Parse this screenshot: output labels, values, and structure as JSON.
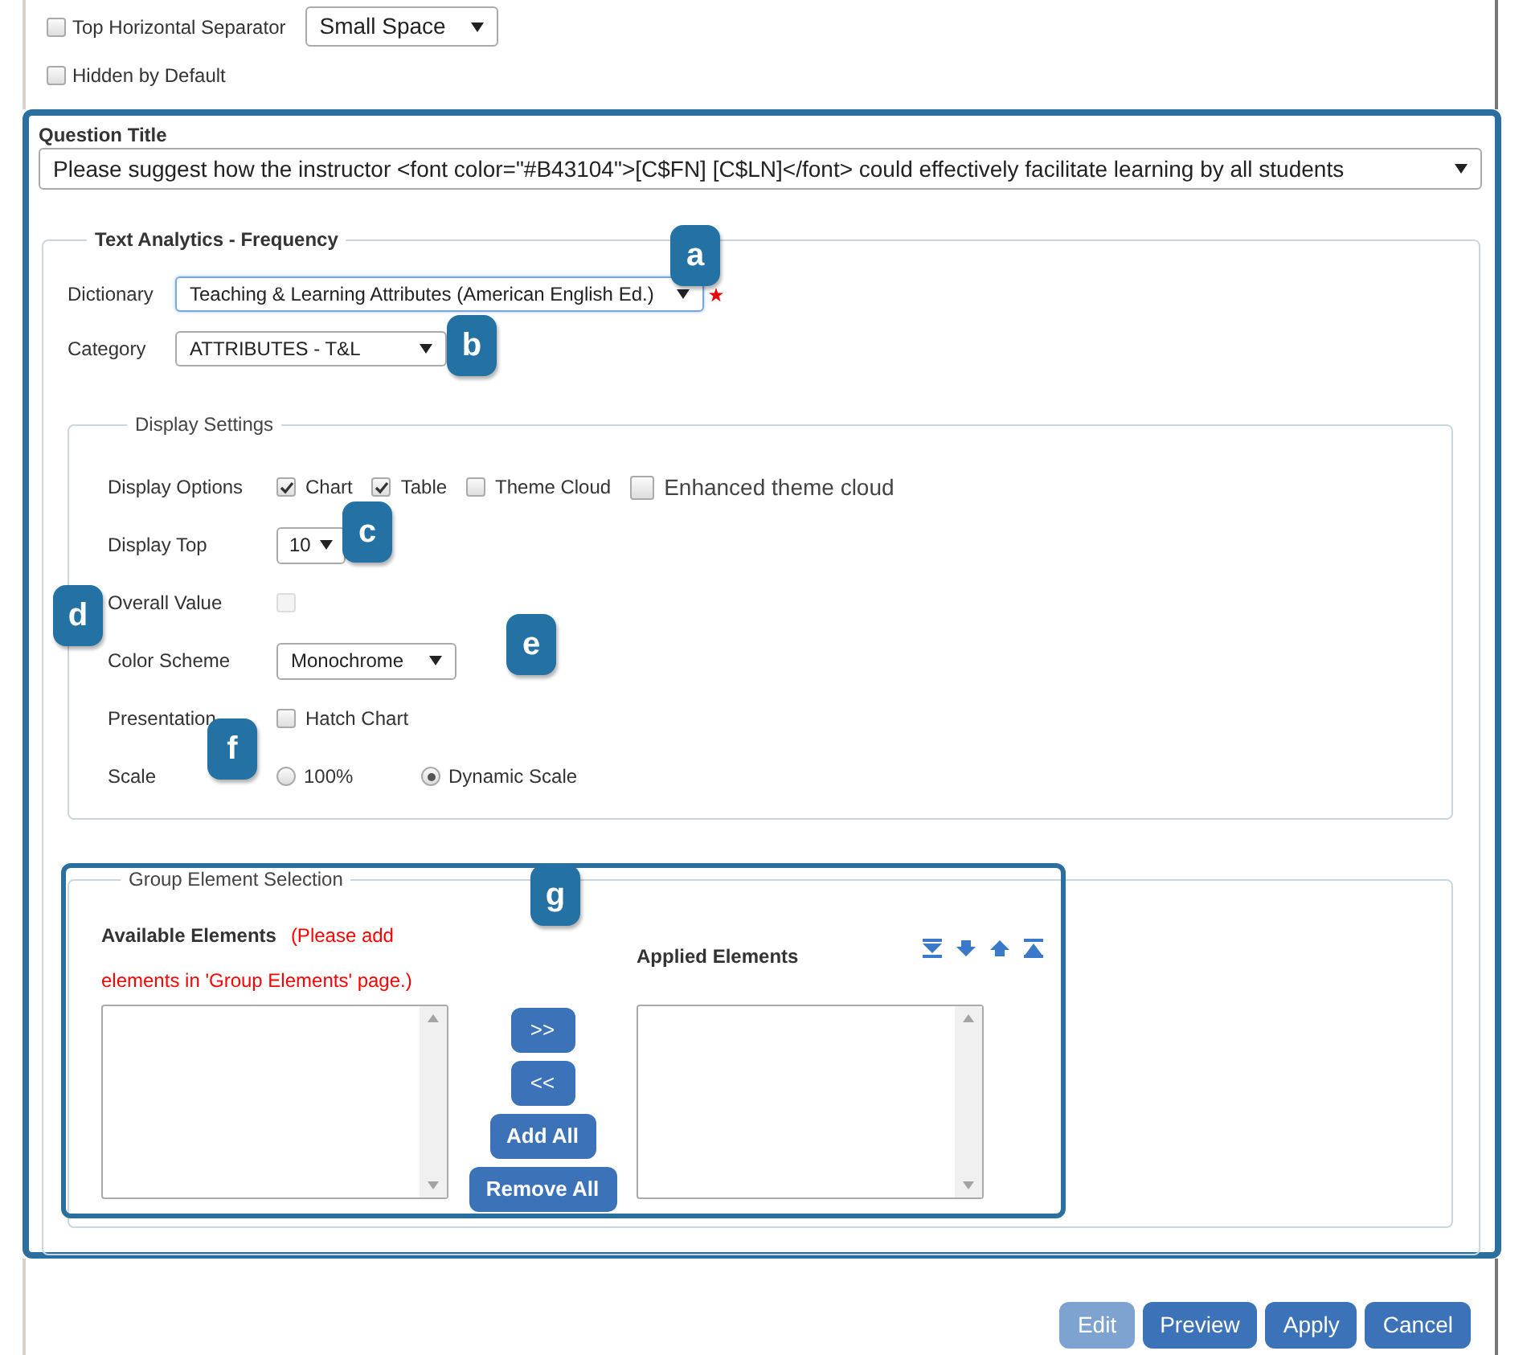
{
  "separator": {
    "label": "Top Horizontal Separator",
    "checked": false,
    "value": "Small Space"
  },
  "hidden_by_default": {
    "label": "Hidden by Default",
    "checked": false
  },
  "question_title": {
    "label": "Question Title",
    "value": "Please suggest how the instructor <font color=\"#B43104\">[C$FN] [C$LN]</font> could effectively facilitate learning by all students"
  },
  "text_analytics": {
    "legend": "Text Analytics - Frequency",
    "dictionary": {
      "label": "Dictionary",
      "value": "Teaching & Learning Attributes (American English Ed.)",
      "required": true
    },
    "category": {
      "label": "Category",
      "value": "ATTRIBUTES - T&L"
    },
    "display_settings": {
      "legend": "Display Settings",
      "display_options": {
        "label": "Display Options",
        "options": [
          {
            "label": "Chart",
            "checked": true,
            "kind": "normal"
          },
          {
            "label": "Table",
            "checked": true,
            "kind": "normal"
          },
          {
            "label": "Theme Cloud",
            "checked": false,
            "kind": "normal"
          },
          {
            "label": "Enhanced theme cloud",
            "checked": false,
            "kind": "large"
          }
        ]
      },
      "display_top": {
        "label": "Display Top",
        "value": "10"
      },
      "overall_value": {
        "label": "Overall Value",
        "checked": false,
        "disabled": true
      },
      "color_scheme": {
        "label": "Color Scheme",
        "value": "Monochrome"
      },
      "presentation": {
        "label": "Presentation",
        "option": {
          "label": "Hatch Chart",
          "checked": false
        }
      },
      "scale": {
        "label": "Scale",
        "options": [
          {
            "label": "100%",
            "selected": false
          },
          {
            "label": "Dynamic Scale",
            "selected": true
          }
        ]
      }
    },
    "group_selection": {
      "legend": "Group Element Selection",
      "available": {
        "label": "Available Elements",
        "note": "(Please add elements in 'Group Elements' page.)"
      },
      "applied": {
        "label": "Applied Elements"
      },
      "move_buttons": [
        ">>",
        "<<",
        "Add All",
        "Remove All"
      ]
    }
  },
  "buttons": [
    {
      "label": "Edit",
      "disabled": true
    },
    {
      "label": "Preview",
      "disabled": false
    },
    {
      "label": "Apply",
      "disabled": false
    },
    {
      "label": "Cancel",
      "disabled": false
    }
  ],
  "callouts": [
    "a",
    "b",
    "c",
    "d",
    "e",
    "f",
    "g"
  ]
}
